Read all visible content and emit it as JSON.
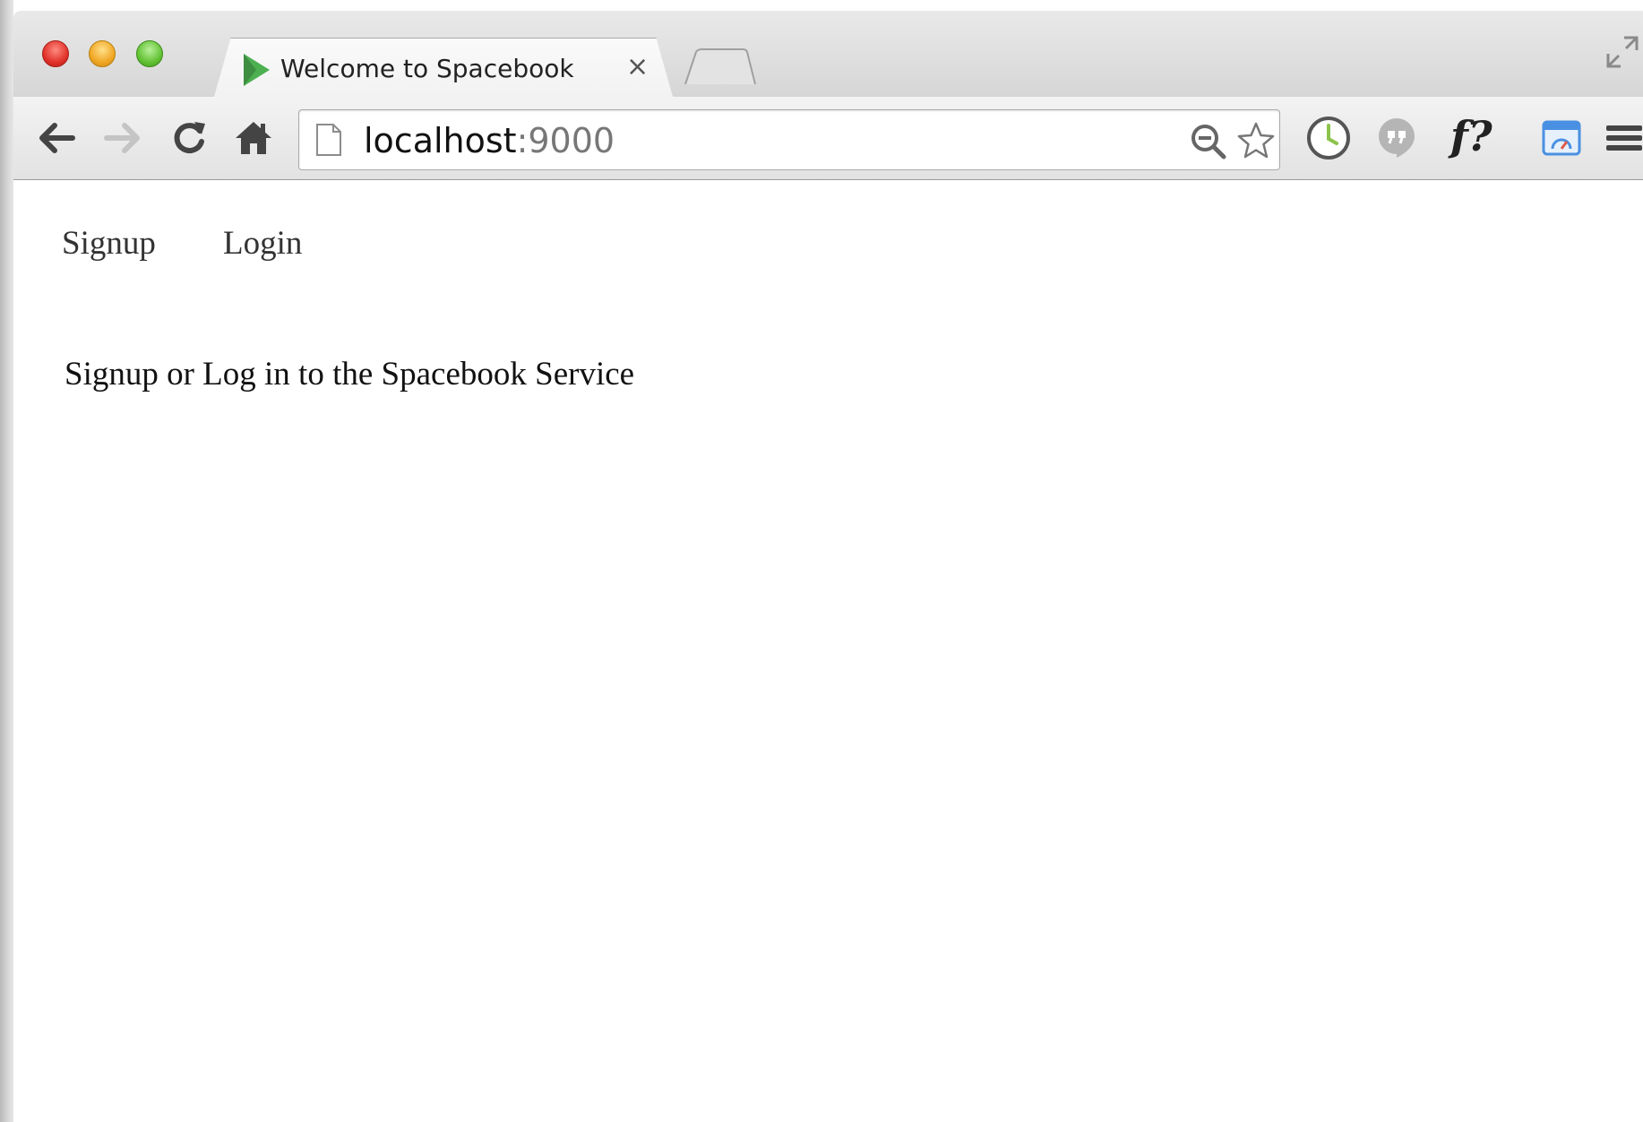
{
  "tab": {
    "title": "Welcome to Spacebook",
    "close_glyph": "×"
  },
  "omnibox": {
    "host": "localhost",
    "port": ":9000"
  },
  "nav": {
    "items": [
      {
        "label": "Signup"
      },
      {
        "label": "Login"
      }
    ]
  },
  "main": {
    "lead": "Signup or Log in to the Spacebook Service"
  },
  "extensions": {
    "font_ext_label": "f?"
  },
  "colors": {
    "favicon_green": "#4caf50",
    "clock_green": "#8bc34a",
    "dashboard_blue": "#4a90e2"
  }
}
